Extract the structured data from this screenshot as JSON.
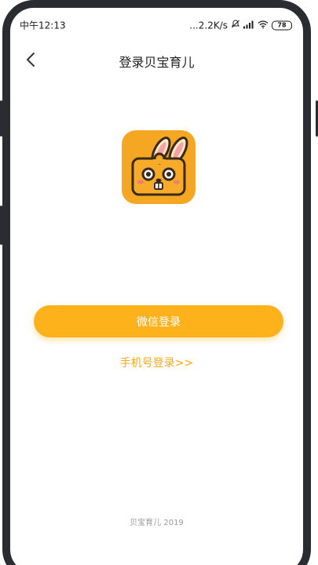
{
  "status_bar": {
    "time": "中午12:13",
    "network_speed": "...2.2K/s",
    "battery_level": "78"
  },
  "nav": {
    "title": "登录贝宝育儿"
  },
  "login": {
    "wechat_button_label": "微信登录",
    "phone_login_label": "手机号登录>>"
  },
  "footer": {
    "copyright": "贝宝育儿 2019"
  },
  "colors": {
    "accent": "#fdb21c",
    "link": "#f7a81b",
    "logo_bg": "#f5a623"
  }
}
